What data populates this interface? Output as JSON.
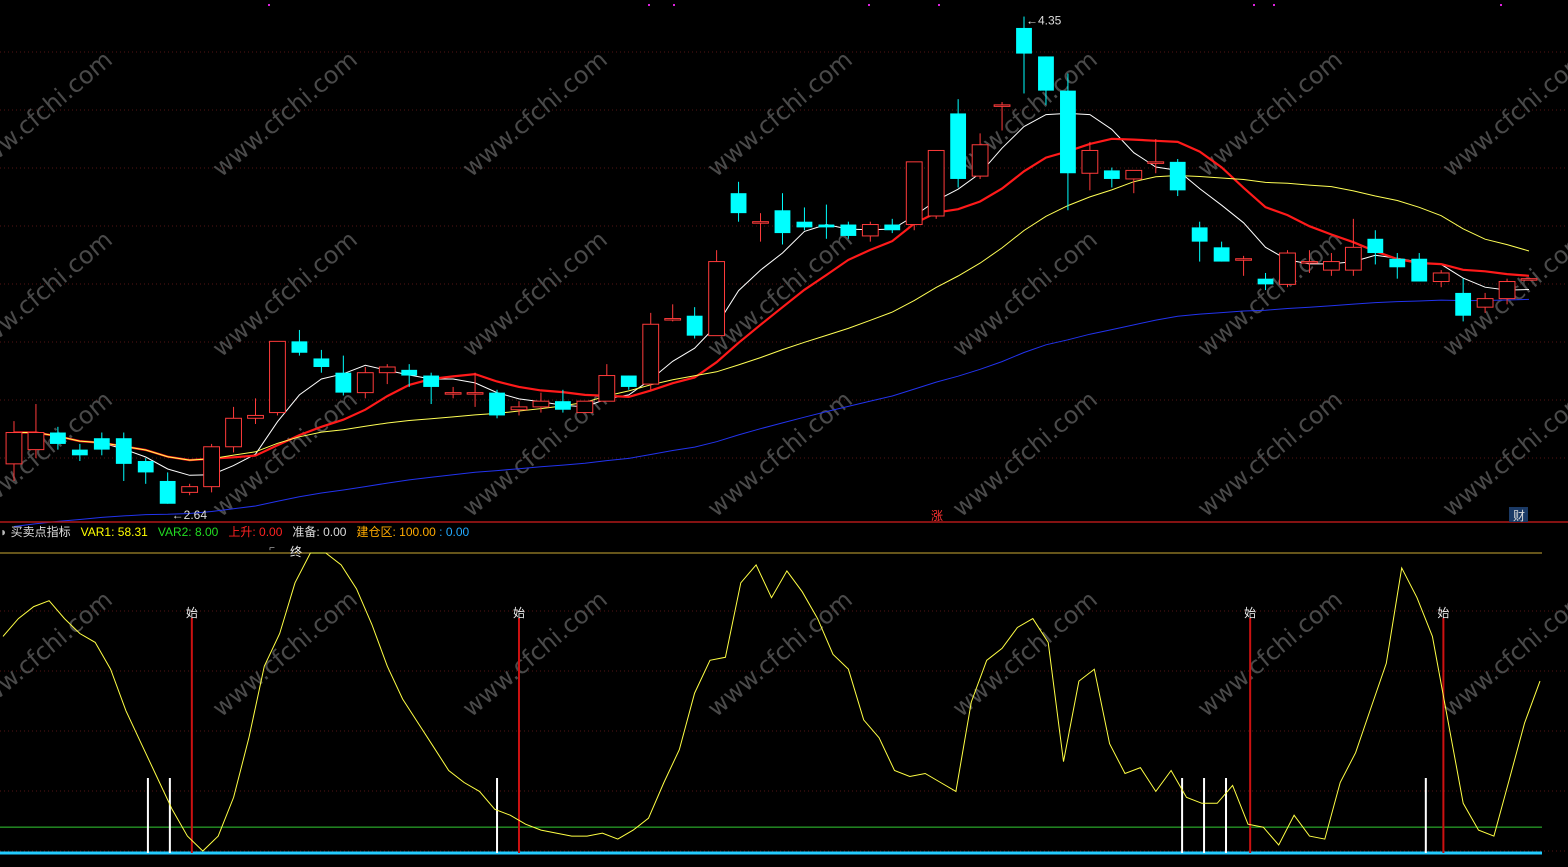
{
  "chart_data": {
    "type": "candlestick",
    "price_panel": {
      "high_label": "4.35",
      "low_label": "2.64",
      "candles": [
        [
          2.78,
          2.89,
          2.72,
          2.93
        ],
        [
          2.83,
          2.89,
          2.8,
          2.99
        ],
        [
          2.89,
          2.85,
          2.83,
          2.91
        ],
        [
          2.83,
          2.81,
          2.79,
          2.85
        ],
        [
          2.87,
          2.83,
          2.81,
          2.89
        ],
        [
          2.87,
          2.78,
          2.72,
          2.89
        ],
        [
          2.79,
          2.75,
          2.71,
          2.8
        ],
        [
          2.72,
          2.64,
          2.64,
          2.75
        ],
        [
          2.68,
          2.7,
          2.67,
          2.71
        ],
        [
          2.7,
          2.84,
          2.68,
          2.85
        ],
        [
          2.84,
          2.94,
          2.82,
          2.98
        ],
        [
          2.94,
          2.95,
          2.92,
          3.01
        ],
        [
          2.96,
          3.21,
          2.95,
          3.21
        ],
        [
          3.21,
          3.17,
          3.16,
          3.25
        ],
        [
          3.15,
          3.12,
          3.1,
          3.18
        ],
        [
          3.1,
          3.03,
          3.02,
          3.16
        ],
        [
          3.03,
          3.1,
          3.01,
          3.12
        ],
        [
          3.1,
          3.12,
          3.06,
          3.13
        ],
        [
          3.11,
          3.09,
          3.05,
          3.13
        ],
        [
          3.09,
          3.05,
          2.99,
          3.1
        ],
        [
          3.03,
          3.03,
          3.01,
          3.05
        ],
        [
          3.03,
          3.03,
          2.98,
          3.1
        ],
        [
          3.03,
          2.95,
          2.94,
          3.04
        ],
        [
          2.97,
          2.98,
          2.95,
          3.0
        ],
        [
          2.98,
          3.0,
          2.96,
          3.03
        ],
        [
          3.0,
          2.97,
          2.96,
          3.04
        ],
        [
          2.96,
          3.0,
          2.96,
          3.0
        ],
        [
          3.0,
          3.09,
          3.0,
          3.13
        ],
        [
          3.09,
          3.05,
          3.04,
          3.09
        ],
        [
          3.06,
          3.27,
          3.04,
          3.31
        ],
        [
          3.29,
          3.29,
          3.28,
          3.34
        ],
        [
          3.3,
          3.23,
          3.22,
          3.33
        ],
        [
          3.23,
          3.49,
          3.23,
          3.53
        ],
        [
          3.73,
          3.66,
          3.63,
          3.77
        ],
        [
          3.63,
          3.63,
          3.56,
          3.66
        ],
        [
          3.67,
          3.59,
          3.55,
          3.73
        ],
        [
          3.63,
          3.61,
          3.6,
          3.68
        ],
        [
          3.62,
          3.61,
          3.57,
          3.69
        ],
        [
          3.62,
          3.58,
          3.57,
          3.63
        ],
        [
          3.58,
          3.62,
          3.56,
          3.63
        ],
        [
          3.62,
          3.6,
          3.59,
          3.64
        ],
        [
          3.62,
          3.84,
          3.6,
          3.84
        ],
        [
          3.65,
          3.88,
          3.64,
          3.88
        ],
        [
          4.01,
          3.78,
          3.75,
          4.06
        ],
        [
          3.79,
          3.9,
          3.78,
          3.94
        ],
        [
          4.04,
          4.04,
          3.95,
          4.05
        ],
        [
          4.31,
          4.22,
          4.08,
          4.35
        ],
        [
          4.21,
          4.09,
          4.04,
          4.21
        ],
        [
          4.09,
          3.8,
          3.67,
          4.15
        ],
        [
          3.8,
          3.88,
          3.74,
          3.91
        ],
        [
          3.81,
          3.78,
          3.75,
          3.82
        ],
        [
          3.78,
          3.81,
          3.73,
          3.81
        ],
        [
          3.84,
          3.84,
          3.8,
          3.92
        ],
        [
          3.84,
          3.74,
          3.72,
          3.85
        ],
        [
          3.61,
          3.56,
          3.49,
          3.63
        ],
        [
          3.54,
          3.49,
          3.49,
          3.56
        ],
        [
          3.5,
          3.5,
          3.44,
          3.51
        ],
        [
          3.43,
          3.41,
          3.39,
          3.45
        ],
        [
          3.41,
          3.52,
          3.4,
          3.53
        ],
        [
          3.49,
          3.49,
          3.45,
          3.53
        ],
        [
          3.46,
          3.49,
          3.44,
          3.52
        ],
        [
          3.46,
          3.54,
          3.44,
          3.64
        ],
        [
          3.57,
          3.52,
          3.48,
          3.6
        ],
        [
          3.5,
          3.47,
          3.43,
          3.52
        ],
        [
          3.5,
          3.42,
          3.42,
          3.52
        ],
        [
          3.42,
          3.45,
          3.4,
          3.46
        ],
        [
          3.38,
          3.3,
          3.28,
          3.43
        ],
        [
          3.33,
          3.36,
          3.31,
          3.38
        ],
        [
          3.36,
          3.42,
          3.34,
          3.43
        ],
        [
          3.43,
          3.43,
          3.43,
          3.43
        ]
      ],
      "ma_lines": [
        {
          "name": "MA5",
          "color": "#ffffff"
        },
        {
          "name": "MA10",
          "color": "#ff1a1a"
        },
        {
          "name": "MA20",
          "color": "#ffff55"
        },
        {
          "name": "MA60",
          "color": "#2233ee"
        }
      ],
      "markers": [
        {
          "text": "涨",
          "color": "#ff3333"
        },
        {
          "text": "财",
          "color": "#55aaff"
        }
      ]
    },
    "indicator_panel": {
      "name": "买卖点指标",
      "legend": [
        {
          "label": "VAR1: ",
          "value": "58.31",
          "color": "#ffff00"
        },
        {
          "label": "VAR2: ",
          "value": "8.00",
          "color": "#22dd22"
        },
        {
          "label": "上升: ",
          "value": "0.00",
          "color": "#ff2222"
        },
        {
          "label": "准备: ",
          "value": "0.00",
          "color": "#dddddd"
        },
        {
          "label": "建仓区: ",
          "value": "100.00",
          "color": "#ffaa00"
        },
        {
          "label": " : ",
          "value": "0.00",
          "color": "#22aaff"
        }
      ],
      "ylim": [
        0,
        100
      ],
      "var1": [
        72,
        78,
        82,
        84,
        78,
        73,
        70,
        61,
        47,
        36,
        25,
        14,
        5,
        0,
        5,
        18,
        38,
        62,
        73,
        90,
        100,
        100,
        96,
        88,
        76,
        62,
        51,
        43,
        35,
        27,
        23,
        20,
        14,
        12,
        9,
        7,
        6,
        5,
        5,
        6,
        4,
        7,
        11,
        23,
        34,
        53,
        64,
        65,
        90,
        96,
        85,
        94,
        87,
        78,
        66,
        61,
        44,
        38,
        27,
        25,
        26,
        23,
        20,
        50,
        64,
        68,
        75,
        78,
        70,
        30,
        57,
        61,
        36,
        26,
        28,
        20,
        27,
        18,
        16,
        16,
        22,
        9,
        8,
        2,
        12,
        5,
        4,
        23,
        33,
        48,
        63,
        95,
        85,
        72,
        44,
        16,
        7,
        5,
        24,
        43,
        57
      ]
    },
    "annotations": {
      "start_label": "始",
      "end_label": "终"
    },
    "watermark": "www.cfchi.com"
  }
}
